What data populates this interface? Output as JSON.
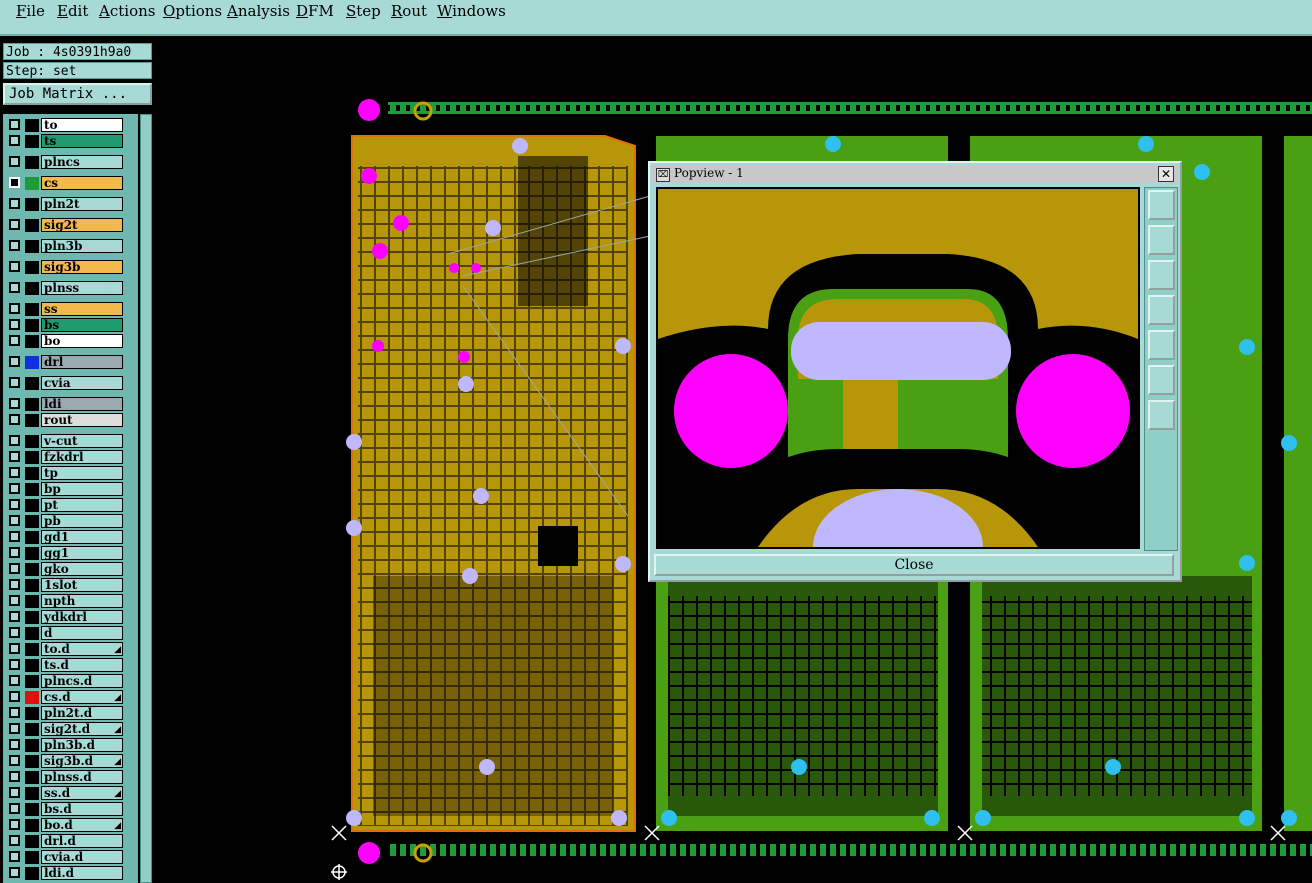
{
  "menu": [
    "File",
    "Edit",
    "Actions",
    "Options",
    "Analysis",
    "DFM",
    "Step",
    "Rout",
    "Windows"
  ],
  "job": {
    "job_label": "Job : 4s0391h9a0",
    "step_label": "Step: set",
    "matrix_button": "Job Matrix ..."
  },
  "layers": [
    {
      "name": "to",
      "color": "#ffffff"
    },
    {
      "name": "ts",
      "color": "#1f9b6e"
    },
    {
      "name": "plncs",
      "color": "#a7d9d5"
    },
    {
      "name": "cs",
      "color": "#f2b94c",
      "active": true
    },
    {
      "name": "pln2t",
      "color": "#a7d9d5"
    },
    {
      "name": "sig2t",
      "color": "#f2b94c"
    },
    {
      "name": "pln3b",
      "color": "#a7d9d5"
    },
    {
      "name": "sig3b",
      "color": "#f2b94c"
    },
    {
      "name": "plnss",
      "color": "#a7d9d5"
    },
    {
      "name": "ss",
      "color": "#f2b94c"
    },
    {
      "name": "bs",
      "color": "#1f9b6e"
    },
    {
      "name": "bo",
      "color": "#ffffff"
    },
    {
      "name": "drl",
      "color": "#9aa8b0",
      "swatch": "#1030e0"
    },
    {
      "name": "cvia",
      "color": "#a7d9d5"
    },
    {
      "name": "ldi",
      "color": "#9aa8b0"
    },
    {
      "name": "rout",
      "color": "#dddddd"
    },
    {
      "name": "v-cut",
      "color": "#a7d9d5"
    },
    {
      "name": "fzkdrl",
      "color": "#a7d9d5"
    },
    {
      "name": "tp",
      "color": "#a7d9d5"
    },
    {
      "name": "bp",
      "color": "#a7d9d5"
    },
    {
      "name": "pt",
      "color": "#a7d9d5"
    },
    {
      "name": "pb",
      "color": "#a7d9d5"
    },
    {
      "name": "gd1",
      "color": "#a7d9d5"
    },
    {
      "name": "gg1",
      "color": "#a7d9d5"
    },
    {
      "name": "gko",
      "color": "#a7d9d5"
    },
    {
      "name": "1slot",
      "color": "#a7d9d5"
    },
    {
      "name": "npth",
      "color": "#a7d9d5"
    },
    {
      "name": "ydkdrl",
      "color": "#a7d9d5"
    },
    {
      "name": "d",
      "color": "#a7d9d5"
    },
    {
      "name": "to.d",
      "color": "#a7d9d5",
      "flag": true
    },
    {
      "name": "ts.d",
      "color": "#a7d9d5"
    },
    {
      "name": "plncs.d",
      "color": "#a7d9d5"
    },
    {
      "name": "cs.d",
      "color": "#a7d9d5",
      "swatch": "#e01010",
      "flag": true
    },
    {
      "name": "pln2t.d",
      "color": "#a7d9d5"
    },
    {
      "name": "sig2t.d",
      "color": "#a7d9d5",
      "flag": true
    },
    {
      "name": "pln3b.d",
      "color": "#a7d9d5"
    },
    {
      "name": "sig3b.d",
      "color": "#a7d9d5",
      "flag": true
    },
    {
      "name": "plnss.d",
      "color": "#a7d9d5"
    },
    {
      "name": "ss.d",
      "color": "#a7d9d5",
      "flag": true
    },
    {
      "name": "bs.d",
      "color": "#a7d9d5"
    },
    {
      "name": "bo.d",
      "color": "#a7d9d5",
      "flag": true
    },
    {
      "name": "drl.d",
      "color": "#a7d9d5"
    },
    {
      "name": "cvia.d",
      "color": "#a7d9d5"
    },
    {
      "name": "ldi.d",
      "color": "#a7d9d5"
    }
  ],
  "popview": {
    "title": "Popview - 1",
    "close_label": "Close",
    "tools": [
      "zoom-window-icon",
      "zoom-in-icon",
      "zoom-out-icon",
      "pan-left-icon",
      "pan-right-icon",
      "fit-icon",
      "pan-icon"
    ]
  },
  "colors": {
    "board_active": "#b8960a",
    "board_other": "#49a012",
    "pad_magenta": "#ff00ff",
    "pad_lavender": "#c0b8ff",
    "pad_cyan": "#30c0f0"
  }
}
